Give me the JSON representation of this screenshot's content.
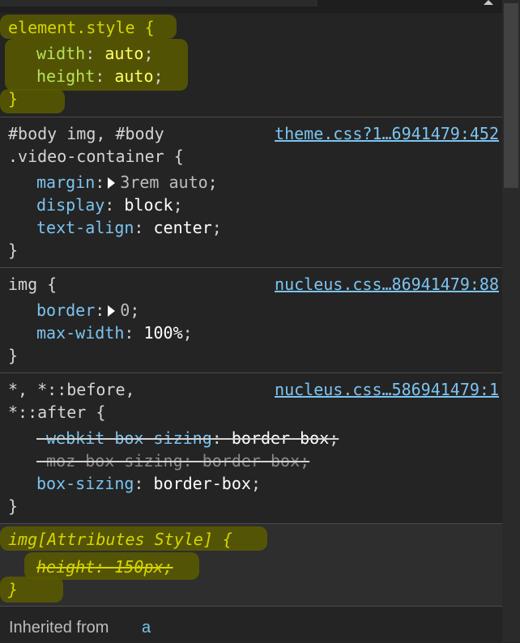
{
  "top": {
    "scroll": "horizontal"
  },
  "rules": [
    {
      "selector": "element.style {",
      "declarations": [
        {
          "prop": "width",
          "value": "auto"
        },
        {
          "prop": "height",
          "value": "auto"
        }
      ],
      "close": "}"
    },
    {
      "selector_line1": "#body img, #body",
      "selector_line2": ".video-container {",
      "source": "theme.css?1…6941479:452",
      "declarations": [
        {
          "prop": "margin",
          "value": "3rem auto"
        },
        {
          "prop": "display",
          "value": "block"
        },
        {
          "prop": "text-align",
          "value": "center"
        }
      ],
      "close": "}"
    },
    {
      "selector": "img {",
      "source": "nucleus.css…86941479:88",
      "declarations": [
        {
          "prop": "border",
          "value": "0"
        },
        {
          "prop": "max-width",
          "value": "100%"
        }
      ],
      "close": "}"
    },
    {
      "selector_line1": "*, *::before,",
      "selector_line2": "*::after {",
      "source": "nucleus.css…586941479:1",
      "declarations": [
        {
          "prop": "-webkit-box-sizing",
          "value": "border-box"
        },
        {
          "prop": "-moz-box-sizing",
          "value": "border-box"
        },
        {
          "prop": "box-sizing",
          "value": "border-box"
        }
      ],
      "close": "}"
    },
    {
      "selector": "img[Attributes Style] {",
      "declarations": [
        {
          "prop": "height",
          "value": "150px"
        }
      ],
      "close": "}"
    }
  ],
  "inherited": {
    "label": "Inherited from",
    "tag": "a"
  },
  "colors": {
    "property": "#7cc4f0",
    "value": "#ffffff",
    "highlight": "#5b5a00",
    "user_agent": "#d6d600"
  }
}
